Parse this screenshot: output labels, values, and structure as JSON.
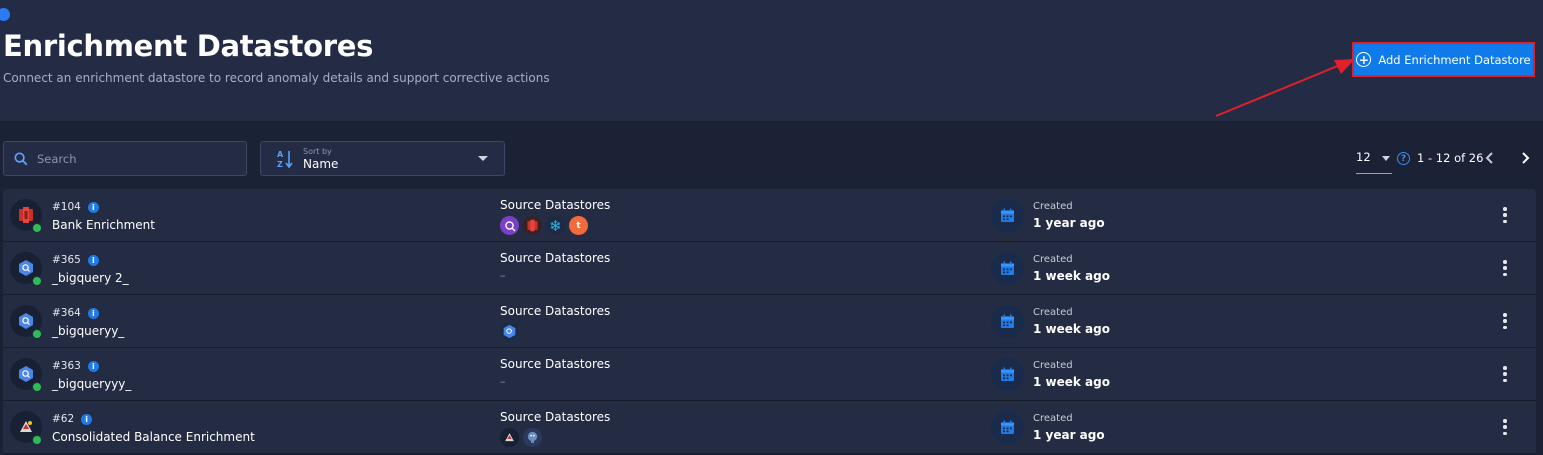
{
  "header": {
    "title": "Enrichment Datastores",
    "subtitle": "Connect an enrichment datastore to record anomaly details and support corrective actions",
    "add_button_label": "Add Enrichment Datastore"
  },
  "toolbar": {
    "search_placeholder": "Search",
    "sort_label": "Sort by",
    "sort_value": "Name"
  },
  "pagination": {
    "per_page": "12",
    "range": "1 - 12 of 26"
  },
  "rows": [
    {
      "id": "#104",
      "name": "Bank Enrichment",
      "source_label": "Source Datastores",
      "sources": [
        "bigquery-purple-icon",
        "redshift-icon",
        "snowflake-icon",
        "teradata-icon"
      ],
      "source_empty": "",
      "created_label": "Created",
      "created_value": "1 year ago",
      "icon": "redshift-icon"
    },
    {
      "id": "#365",
      "name": "_bigquery 2_",
      "source_label": "Source Datastores",
      "sources": [],
      "source_empty": "–",
      "created_label": "Created",
      "created_value": "1 week ago",
      "icon": "bigquery-icon"
    },
    {
      "id": "#364",
      "name": "_bigqueryy_",
      "source_label": "Source Datastores",
      "sources": [
        "bigquery-icon"
      ],
      "source_empty": "",
      "created_label": "Created",
      "created_value": "1 week ago",
      "icon": "bigquery-icon"
    },
    {
      "id": "#363",
      "name": "_bigqueryyy_",
      "source_label": "Source Datastores",
      "sources": [],
      "source_empty": "–",
      "created_label": "Created",
      "created_value": "1 week ago",
      "icon": "bigquery-icon"
    },
    {
      "id": "#62",
      "name": "Consolidated Balance Enrichment",
      "source_label": "Source Datastores",
      "sources": [
        "hive-icon",
        "postgresql-icon"
      ],
      "source_empty": "",
      "created_label": "Created",
      "created_value": "1 year ago",
      "icon": "hive-icon"
    }
  ],
  "colors": {
    "accent": "#0f7bea",
    "highlight_border": "#e0202a",
    "status_ok": "#2dbd54",
    "background": "#1b2236",
    "panel": "#242c44"
  }
}
